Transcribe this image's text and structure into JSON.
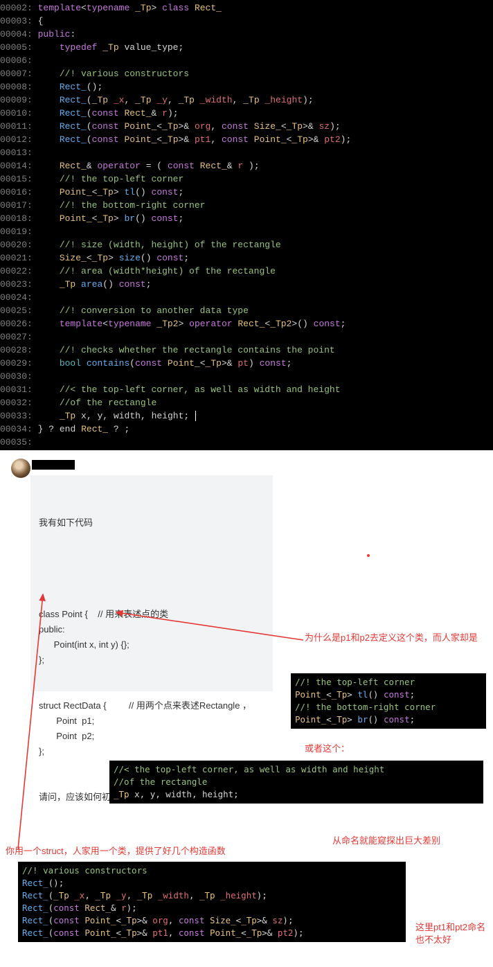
{
  "code_main": {
    "lines": [
      {
        "n": "00002:",
        "h": "<span class='kw'>template</span><span class='op'>&lt;</span><span class='kw'>typename</span> <span class='ty'>_Tp</span><span class='op'>&gt;</span> <span class='kw'>class</span> <span class='ty'>Rect_</span>"
      },
      {
        "n": "00003:",
        "h": "<span class='op'>{</span>"
      },
      {
        "n": "00004:",
        "h": "<span class='kw'>public</span><span class='op'>:</span>"
      },
      {
        "n": "00005:",
        "h": "    <span class='kw'>typedef</span> <span class='ty'>_Tp</span> <span class='id'>value_type</span><span class='op'>;</span>"
      },
      {
        "n": "00006:",
        "h": ""
      },
      {
        "n": "00007:",
        "h": "    <span class='cm'>//! various constructors</span>"
      },
      {
        "n": "00008:",
        "h": "    <span class='fn'>Rect_</span><span class='op'>();</span>"
      },
      {
        "n": "00009:",
        "h": "    <span class='fn'>Rect_</span><span class='op'>(</span><span class='ty'>_Tp</span> <span class='pm'>_x</span><span class='op'>,</span> <span class='ty'>_Tp</span> <span class='pm'>_y</span><span class='op'>,</span> <span class='ty'>_Tp</span> <span class='pm'>_width</span><span class='op'>,</span> <span class='ty'>_Tp</span> <span class='pm'>_height</span><span class='op'>);</span>"
      },
      {
        "n": "00010:",
        "h": "    <span class='fn'>Rect_</span><span class='op'>(</span><span class='kw'>const</span> <span class='ty'>Rect_</span><span class='op'>&amp;</span> <span class='pm'>r</span><span class='op'>);</span>"
      },
      {
        "n": "00011:",
        "h": "    <span class='fn'>Rect_</span><span class='op'>(</span><span class='kw'>const</span> <span class='ty'>Point_</span><span class='op'>&lt;</span><span class='ty'>_Tp</span><span class='op'>&gt;&amp;</span> <span class='pm'>org</span><span class='op'>,</span> <span class='kw'>const</span> <span class='ty'>Size_</span><span class='op'>&lt;</span><span class='ty'>_Tp</span><span class='op'>&gt;&amp;</span> <span class='pm'>sz</span><span class='op'>);</span>"
      },
      {
        "n": "00012:",
        "h": "    <span class='fn'>Rect_</span><span class='op'>(</span><span class='kw'>const</span> <span class='ty'>Point_</span><span class='op'>&lt;</span><span class='ty'>_Tp</span><span class='op'>&gt;&amp;</span> <span class='pm'>pt1</span><span class='op'>,</span> <span class='kw'>const</span> <span class='ty'>Point_</span><span class='op'>&lt;</span><span class='ty'>_Tp</span><span class='op'>&gt;&amp;</span> <span class='pm'>pt2</span><span class='op'>);</span>"
      },
      {
        "n": "00013:",
        "h": ""
      },
      {
        "n": "00014:",
        "h": "    <span class='ty'>Rect_</span><span class='op'>&amp;</span> <span class='kw'>operator</span> <span class='op'>= (</span> <span class='kw'>const</span> <span class='ty'>Rect_</span><span class='op'>&amp;</span> <span class='pm'>r</span> <span class='op'>);</span>"
      },
      {
        "n": "00015:",
        "h": "    <span class='cm'>//! the top-left corner</span>"
      },
      {
        "n": "00016:",
        "h": "    <span class='ty'>Point_</span><span class='op'>&lt;</span><span class='ty'>_Tp</span><span class='op'>&gt;</span> <span class='fn'>tl</span><span class='op'>()</span> <span class='kw'>const</span><span class='op'>;</span>"
      },
      {
        "n": "00017:",
        "h": "    <span class='cm'>//! the bottom-right corner</span>"
      },
      {
        "n": "00018:",
        "h": "    <span class='ty'>Point_</span><span class='op'>&lt;</span><span class='ty'>_Tp</span><span class='op'>&gt;</span> <span class='fn'>br</span><span class='op'>()</span> <span class='kw'>const</span><span class='op'>;</span>"
      },
      {
        "n": "00019:",
        "h": ""
      },
      {
        "n": "00020:",
        "h": "    <span class='cm'>//! size (width, height) of the rectangle</span>"
      },
      {
        "n": "00021:",
        "h": "    <span class='ty'>Size_</span><span class='op'>&lt;</span><span class='ty'>_Tp</span><span class='op'>&gt;</span> <span class='fn'>size</span><span class='op'>()</span> <span class='kw'>const</span><span class='op'>;</span>"
      },
      {
        "n": "00022:",
        "h": "    <span class='cm'>//! area (width*height) of the rectangle</span>"
      },
      {
        "n": "00023:",
        "h": "    <span class='ty'>_Tp</span> <span class='fn'>area</span><span class='op'>()</span> <span class='kw'>const</span><span class='op'>;</span>"
      },
      {
        "n": "00024:",
        "h": ""
      },
      {
        "n": "00025:",
        "h": "    <span class='cm'>//! conversion to another data type</span>"
      },
      {
        "n": "00026:",
        "h": "    <span class='kw'>template</span><span class='op'>&lt;</span><span class='kw'>typename</span> <span class='ty'>_Tp2</span><span class='op'>&gt;</span> <span class='kw'>operator</span> <span class='ty'>Rect_</span><span class='op'>&lt;</span><span class='ty'>_Tp2</span><span class='op'>&gt;()</span> <span class='kw'>const</span><span class='op'>;</span>"
      },
      {
        "n": "00027:",
        "h": ""
      },
      {
        "n": "00028:",
        "h": "    <span class='cm'>//! checks whether the rectangle contains the point</span>"
      },
      {
        "n": "00029:",
        "h": "    <span class='kw2'>bool</span> <span class='fn'>contains</span><span class='op'>(</span><span class='kw'>const</span> <span class='ty'>Point_</span><span class='op'>&lt;</span><span class='ty'>_Tp</span><span class='op'>&gt;&amp;</span> <span class='pm'>pt</span><span class='op'>)</span> <span class='kw'>const</span><span class='op'>;</span>"
      },
      {
        "n": "00030:",
        "h": ""
      },
      {
        "n": "00031:",
        "h": "    <span class='cm'>//&lt; the top-left corner, as well as width and height</span>"
      },
      {
        "n": "00032:",
        "h": "    <span class='cm'>//of the rectangle</span>"
      },
      {
        "n": "00033:",
        "h": "    <span class='ty'>_Tp</span> <span class='id'>x</span><span class='op'>,</span> <span class='id'>y</span><span class='op'>,</span> <span class='id'>width</span><span class='op'>,</span> <span class='id'>height</span><span class='op'>;</span> <span class='cursor'></span>"
      },
      {
        "n": "00034:",
        "h": "<span class='op'>}</span> <span class='op'>?</span> <span class='id'>end</span> <span class='ty'>Rect_</span> <span class='op'>?</span> <span class='op'>;</span>"
      },
      {
        "n": "00035:",
        "h": ""
      }
    ]
  },
  "question": {
    "intro": "我有如下代码",
    "body": "class Point {    // 用来表述点的类\npublic:\n      Point(int x, int y) {};\n};\n\n\nstruct RectData {         // 用两个点来表述Rectangle ，\n       Point  p1;\n       Point  p2;\n};\n",
    "ask": "请问，应该如何初始化 RectData ？"
  },
  "annotations": {
    "a1": "为什么是p1和p2去定义这个类，而人家却是",
    "a2": "或者这个：",
    "a3": "从命名就能窥探出巨大差别",
    "a4": "你用一个struct，人家用一个类，提供了好几个构造函数",
    "a5": "这里pt1和pt2命名也不太好"
  },
  "snippets": {
    "s1": "<span class='cm'>//! the top-left corner</span>\n<span class='ty'>Point_</span><span class='op'>&lt;</span><span class='ty'>_Tp</span><span class='op'>&gt;</span> <span class='fn'>tl</span><span class='op'>()</span> <span class='kw'>const</span><span class='op'>;</span>\n<span class='cm'>//! the bottom-right corner</span>\n<span class='ty'>Point_</span><span class='op'>&lt;</span><span class='ty'>_Tp</span><span class='op'>&gt;</span> <span class='fn'>br</span><span class='op'>()</span> <span class='kw'>const</span><span class='op'>;</span><span class='cursor'></span>",
    "s2": "<span class='cm'>//&lt; the top-left corner, as well as width and height</span>\n<span class='cm'>//of the rectangle</span>\n<span class='ty'>_Tp</span> <span class='id'>x</span><span class='op'>,</span> <span class='id'>y</span><span class='op'>,</span> <span class='id'>width</span><span class='op'>,</span> <span class='id'>height</span><span class='op'>;</span>",
    "s3": "<span class='cm'>//! various constructors</span>\n<span class='fn'>Rect_</span><span class='op'>();</span>\n<span class='fn'>Rect_</span><span class='op'>(</span><span class='ty'>_Tp</span> <span class='pm'>_x</span><span class='op'>,</span> <span class='ty'>_Tp</span> <span class='pm'>_y</span><span class='op'>,</span> <span class='ty'>_Tp</span> <span class='pm'>_width</span><span class='op'>,</span> <span class='ty'>_Tp</span> <span class='pm'>_height</span><span class='op'>);</span>\n<span class='fn'>Rect_</span><span class='op'>(</span><span class='kw'>const</span> <span class='ty'>Rect_</span><span class='op'>&amp;</span> <span class='pm'>r</span><span class='op'>);</span>\n<span class='fn'>Rect_</span><span class='op'>(</span><span class='kw'>const</span> <span class='ty'>Point_</span><span class='op'>&lt;</span><span class='ty'>_Tp</span><span class='op'>&gt;&amp;</span> <span class='pm'>org</span><span class='op'>,</span> <span class='kw'>const</span> <span class='ty'>Size_</span><span class='op'>&lt;</span><span class='ty'>_Tp</span><span class='op'>&gt;&amp;</span> <span class='pm'>sz</span><span class='op'>);</span>\n<span class='fn'>Rect_</span><span class='op'>(</span><span class='kw'>const</span> <span class='ty'>Point_</span><span class='op'>&lt;</span><span class='ty'>_Tp</span><span class='op'>&gt;&amp;</span> <span class='pm'>pt1</span><span class='op'>,</span> <span class='kw'>const</span> <span class='ty'>Point_</span><span class='op'>&lt;</span><span class='ty'>_Tp</span><span class='op'>&gt;&amp;</span> <span class='pm'>pt2</span><span class='op'>);</span>"
  }
}
